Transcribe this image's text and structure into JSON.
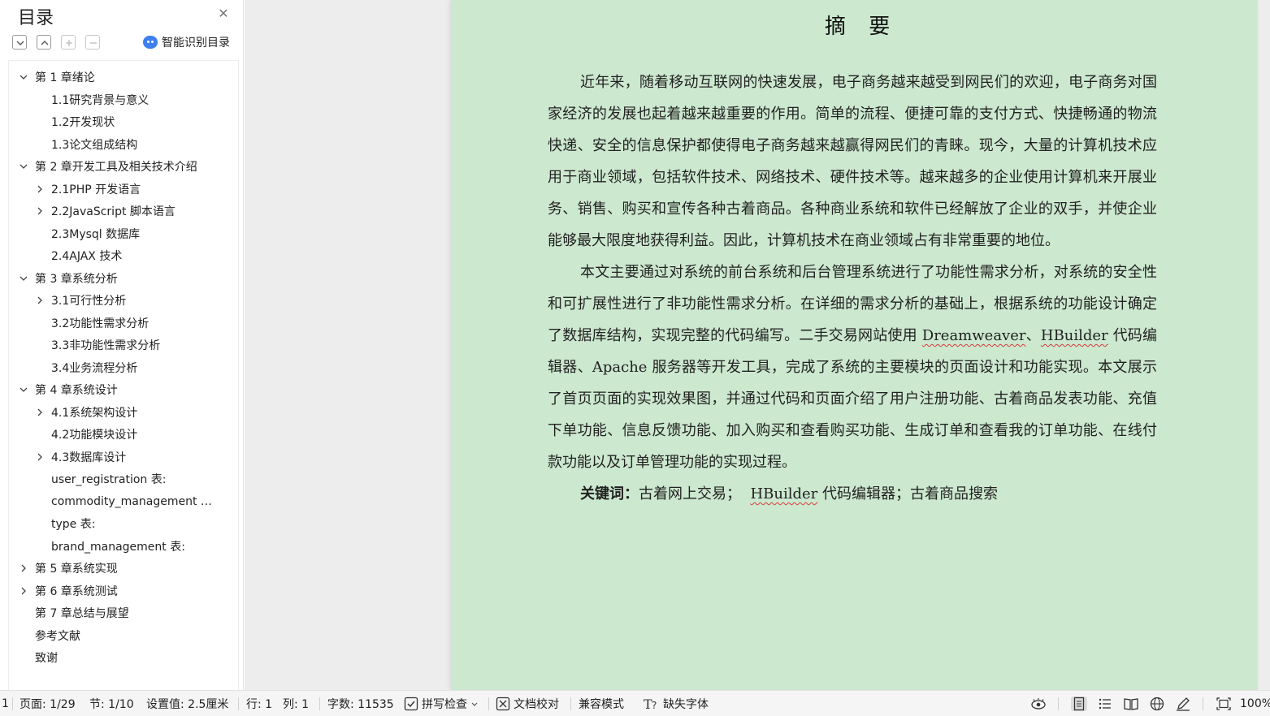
{
  "sidebar": {
    "title": "目录",
    "smart_toc_label": "智能识别目录",
    "toc": [
      {
        "label": "第 1 章绪论",
        "level": 1,
        "state": "expanded"
      },
      {
        "label": "1.1研究背景与意义",
        "level": 2,
        "state": "none"
      },
      {
        "label": "1.2开发现状",
        "level": 2,
        "state": "none"
      },
      {
        "label": "1.3论文组成结构",
        "level": 2,
        "state": "none"
      },
      {
        "label": "第 2 章开发工具及相关技术介绍",
        "level": 1,
        "state": "expanded"
      },
      {
        "label": "2.1PHP 开发语言",
        "level": 2,
        "state": "collapsed"
      },
      {
        "label": "2.2JavaScript 脚本语言",
        "level": 2,
        "state": "collapsed"
      },
      {
        "label": "2.3Mysql 数据库",
        "level": 2,
        "state": "none"
      },
      {
        "label": "2.4AJAX 技术",
        "level": 2,
        "state": "none"
      },
      {
        "label": "第 3 章系统分析",
        "level": 1,
        "state": "expanded"
      },
      {
        "label": "3.1可行性分析",
        "level": 2,
        "state": "collapsed"
      },
      {
        "label": "3.2功能性需求分析",
        "level": 2,
        "state": "none"
      },
      {
        "label": "3.3非功能性需求分析",
        "level": 2,
        "state": "none"
      },
      {
        "label": "3.4业务流程分析",
        "level": 2,
        "state": "none"
      },
      {
        "label": "第 4 章系统设计",
        "level": 1,
        "state": "expanded"
      },
      {
        "label": "4.1系统架构设计",
        "level": 2,
        "state": "collapsed"
      },
      {
        "label": "4.2功能模块设计",
        "level": 2,
        "state": "none"
      },
      {
        "label": "4.3数据库设计",
        "level": 2,
        "state": "collapsed"
      },
      {
        "label": "user_registration 表:",
        "level": 2,
        "state": "none"
      },
      {
        "label": "commodity_management …",
        "level": 2,
        "state": "none"
      },
      {
        "label": "type 表:",
        "level": 2,
        "state": "none"
      },
      {
        "label": "brand_management 表:",
        "level": 2,
        "state": "none"
      },
      {
        "label": "第 5 章系统实现",
        "level": 1,
        "state": "collapsed"
      },
      {
        "label": "第 6 章系统测试",
        "level": 1,
        "state": "collapsed"
      },
      {
        "label": "第 7 章总结与展望",
        "level": 1,
        "state": "none"
      },
      {
        "label": "参考文献",
        "level": 1,
        "state": "none"
      },
      {
        "label": "致谢",
        "level": 1,
        "state": "none"
      }
    ]
  },
  "document": {
    "title": "摘 要",
    "p1": "近年来，随着移动互联网的快速发展，电子商务越来越受到网民们的欢迎，电子商务对国家经济的发展也起着越来越重要的作用。简单的流程、便捷可靠的支付方式、快捷畅通的物流快递、安全的信息保护都使得电子商务越来越赢得网民们的青睐。现今，大量的计算机技术应用于商业领域，包括软件技术、网络技术、硬件技术等。越来越多的企业使用计算机来开展业务、销售、购买和宣传各种古着商品。各种商业系统和软件已经解放了企业的双手，并使企业能够最大限度地获得利益。因此，计算机技术在商业领域占有非常重要的地位。",
    "p2_a": "本文主要通过对系统的前台系统和后台管理系统进行了功能性需求分析，对系统的安全性和可扩展性进行了非功能性需求分析。在详细的需求分析的基础上，根据系统的功能设计确定了数据库结构，实现完整的代码编写。二手交易网站使用 ",
    "p2_dw": "Dreamweaver",
    "p2_b": "、",
    "p2_hb": "HBuilder",
    "p2_c": " 代码编辑器、Apache 服务器等开发工具，完成了系统的主要模块的页面设计和功能实现。本文展示了首页页面的实现效果图，并通过代码和页面介绍了用户注册功能、古着商品发表功能、充值下单功能、信息反馈功能、加入购买和查看购买功能、生成订单和查看我的订单功能、在线付款功能以及订单管理功能的实现过程。",
    "kw_label": "关键词：",
    "kw_a": "古着网上交易；",
    "kw_hb": "HBuilder",
    "kw_b": " 代码编辑器；古着商品搜索"
  },
  "statusbar": {
    "page_index": "1",
    "page": "页面: 1/29",
    "section": "节: 1/10",
    "setting": "设置值: 2.5厘米",
    "row": "行: 1",
    "col": "列: 1",
    "words": "字数: 11535",
    "spell_check": "拼写检查",
    "doc_check": "文档校对",
    "compat_mode": "兼容模式",
    "missing_fonts": "缺失字体",
    "zoom": "100%"
  },
  "colors": {
    "page_background": "#cce8cf",
    "workspace": "#ededed",
    "smart_icon": "#3f7ff0",
    "spell_underline": "#d83b3b"
  }
}
